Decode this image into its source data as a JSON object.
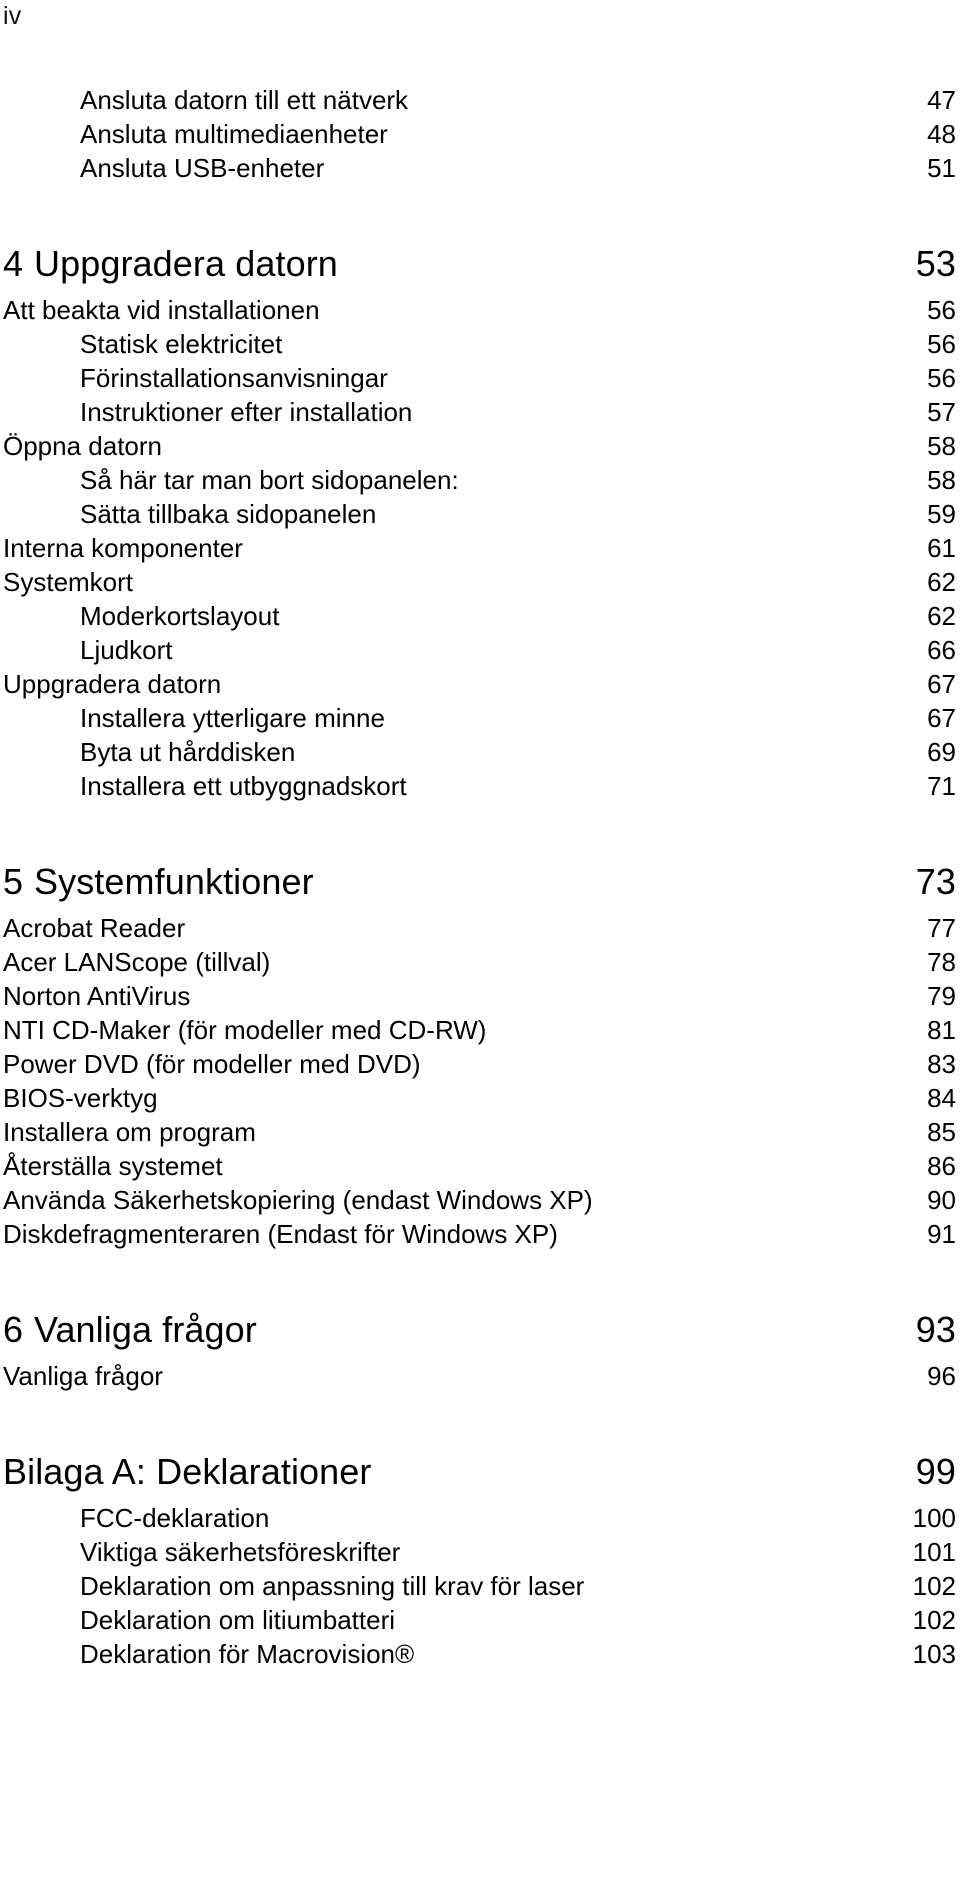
{
  "folio": "iv",
  "toc": {
    "blocks": [
      {
        "id": "chapter3-tail",
        "entries": [
          {
            "level": 1,
            "label": "Ansluta datorn till ett nätverk",
            "page": "47"
          },
          {
            "level": 1,
            "label": "Ansluta multimediaenheter",
            "page": "48"
          },
          {
            "level": 1,
            "label": "Ansluta USB-enheter",
            "page": "51"
          }
        ]
      },
      {
        "id": "chapter4",
        "heading": {
          "num": "4",
          "title": "Uppgradera datorn",
          "page": "53"
        },
        "entries": [
          {
            "level": 0,
            "label": "Att beakta vid installationen",
            "page": "56"
          },
          {
            "level": 1,
            "label": "Statisk elektricitet",
            "page": "56"
          },
          {
            "level": 1,
            "label": "Förinstallationsanvisningar",
            "page": "56"
          },
          {
            "level": 1,
            "label": "Instruktioner efter installation",
            "page": "57"
          },
          {
            "level": 0,
            "label": "Öppna datorn",
            "page": "58"
          },
          {
            "level": 1,
            "label": "Så här tar man bort sidopanelen:",
            "page": "58"
          },
          {
            "level": 1,
            "label": "Sätta tillbaka sidopanelen",
            "page": "59"
          },
          {
            "level": 0,
            "label": "Interna komponenter",
            "page": "61"
          },
          {
            "level": 0,
            "label": "Systemkort",
            "page": "62"
          },
          {
            "level": 1,
            "label": "Moderkortslayout",
            "page": "62"
          },
          {
            "level": 1,
            "label": "Ljudkort",
            "page": "66"
          },
          {
            "level": 0,
            "label": "Uppgradera datorn",
            "page": "67"
          },
          {
            "level": 1,
            "label": "Installera ytterligare minne",
            "page": "67"
          },
          {
            "level": 1,
            "label": "Byta ut hårddisken",
            "page": "69"
          },
          {
            "level": 1,
            "label": "Installera ett utbyggnadskort",
            "page": "71"
          }
        ]
      },
      {
        "id": "chapter5",
        "heading": {
          "num": "5",
          "title": "Systemfunktioner",
          "page": "73"
        },
        "entries": [
          {
            "level": 0,
            "label": "Acrobat Reader",
            "page": "77"
          },
          {
            "level": 0,
            "label": "Acer LANScope (tillval)",
            "page": "78"
          },
          {
            "level": 0,
            "label": "Norton AntiVirus",
            "page": "79"
          },
          {
            "level": 0,
            "label": "NTI CD-Maker (för modeller med CD-RW)",
            "page": "81"
          },
          {
            "level": 0,
            "label": "Power DVD (för modeller med DVD)",
            "page": "83"
          },
          {
            "level": 0,
            "label": "BIOS-verktyg",
            "page": "84"
          },
          {
            "level": 0,
            "label": "Installera om program",
            "page": "85"
          },
          {
            "level": 0,
            "label": "Återställa systemet",
            "page": "86"
          },
          {
            "level": 0,
            "label": "Använda Säkerhetskopiering (endast Windows XP)",
            "page": "90"
          },
          {
            "level": 0,
            "label": "Diskdefragmenteraren (Endast för Windows XP)",
            "page": "91"
          }
        ]
      },
      {
        "id": "chapter6",
        "heading": {
          "num": "6",
          "title": "Vanliga frågor",
          "page": "93"
        },
        "entries": [
          {
            "level": 0,
            "label": "Vanliga frågor",
            "page": "96"
          }
        ]
      },
      {
        "id": "appendixA",
        "heading": {
          "num": "",
          "title": "Bilaga A: Deklarationer",
          "page": "99",
          "appendix": true
        },
        "entries": [
          {
            "level": 1,
            "label": "FCC-deklaration",
            "page": "100"
          },
          {
            "level": 1,
            "label": "Viktiga säkerhetsföreskrifter",
            "page": "101"
          },
          {
            "level": 1,
            "label": "Deklaration om anpassning till krav för laser",
            "page": "102"
          },
          {
            "level": 1,
            "label": "Deklaration om litiumbatteri",
            "page": "102"
          },
          {
            "level": 1,
            "label": "Deklaration för Macrovision®",
            "page": "103"
          }
        ]
      }
    ]
  }
}
